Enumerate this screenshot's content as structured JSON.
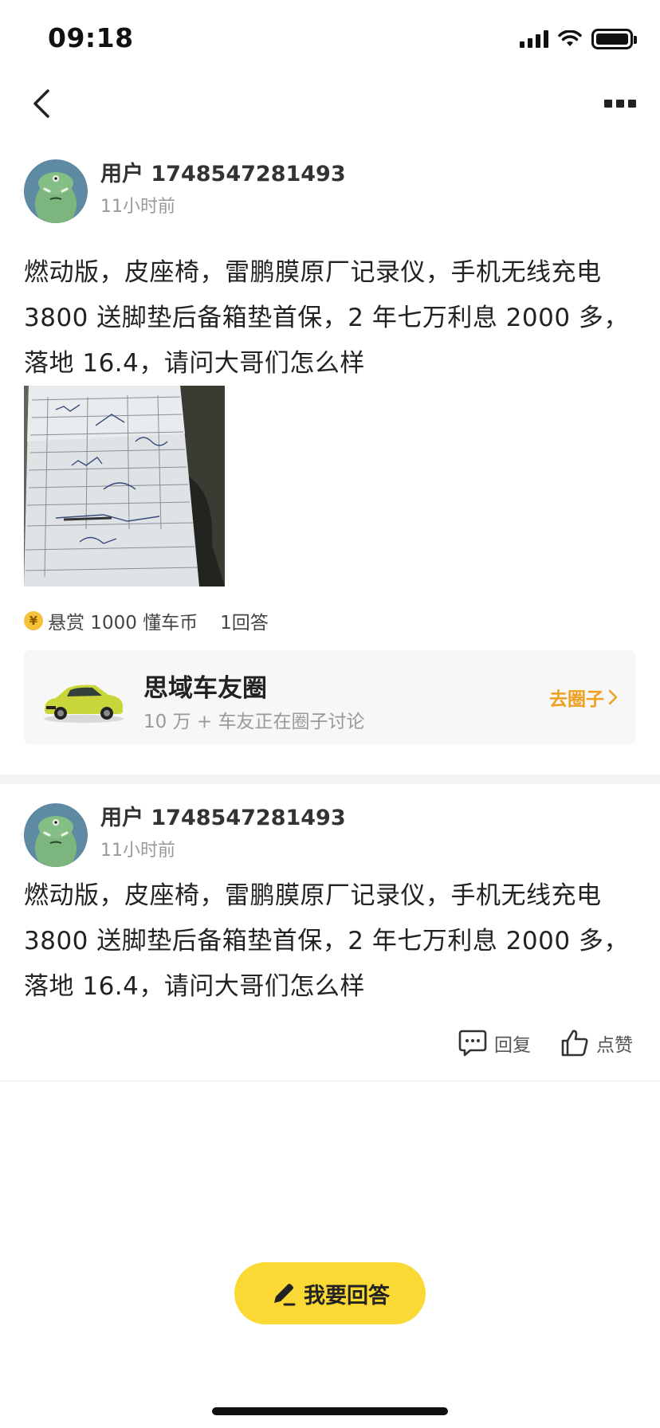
{
  "status_bar": {
    "time": "09:18"
  },
  "post": {
    "user_name": "用户 1748547281493",
    "time_ago": "11小时前",
    "content": "燃动版，皮座椅，雷鹏膜原厂记录仪，手机无线充电 3800 送脚垫后备箱垫首保，2 年七万利息 2000 多，落地 16.4，请问大哥们怎么样",
    "reward_label": "悬赏 1000 懂车币",
    "answer_count": "1回答"
  },
  "circle": {
    "name": "思域车友圈",
    "subtitle": "10 万 + 车友正在圈子讨论",
    "cta": "去圈子"
  },
  "reply": {
    "user_name": "用户 1748547281493",
    "time_ago": "11小时前",
    "content": "燃动版，皮座椅，雷鹏膜原厂记录仪，手机无线充电 3800 送脚垫后备箱垫首保，2 年七万利息 2000 多，落地 16.4，请问大哥们怎么样",
    "reply_label": "回复",
    "like_label": "点赞"
  },
  "answer_button": {
    "label": "我要回答"
  },
  "colors": {
    "accent_yellow": "#fbd935",
    "link_orange": "#f0a020",
    "divider": "#f4f4f4"
  }
}
